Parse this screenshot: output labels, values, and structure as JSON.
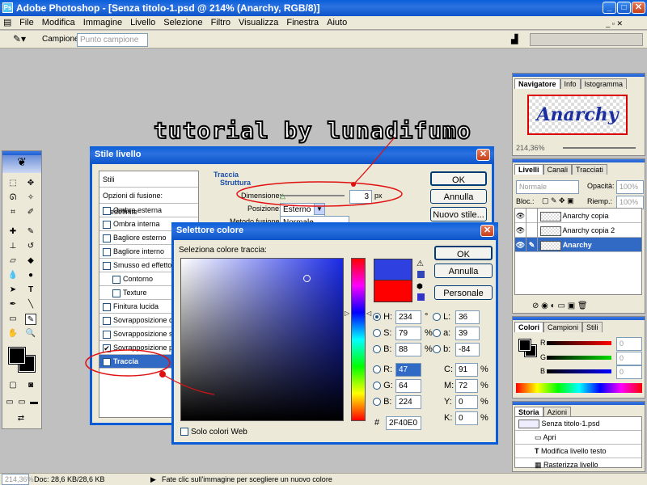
{
  "window": {
    "title": "Adobe Photoshop - [Senza titolo-1.psd @ 214% (Anarchy, RGB/8)]"
  },
  "menu": [
    "File",
    "Modifica",
    "Immagine",
    "Livello",
    "Selezione",
    "Filtro",
    "Visualizza",
    "Finestra",
    "Aiuto"
  ],
  "options": {
    "sample_label": "Campione:",
    "sample_value": "Punto campione"
  },
  "overlay": {
    "caption": "tutorial by lunadifumo"
  },
  "navigator": {
    "tabs": [
      "Navigatore",
      "Info",
      "Istogramma"
    ],
    "zoom": "214,36%",
    "preview_text": "Anarchy"
  },
  "layers_panel": {
    "tabs": [
      "Livelli",
      "Canali",
      "Tracciati"
    ],
    "blend": "Normale",
    "opacity_label": "Opacità:",
    "opacity": "100%",
    "lock_label": "Bloc.:",
    "fill_label": "Riemp.:",
    "fill": "100%",
    "layers": [
      "Anarchy copia",
      "Anarchy copia 2",
      "Anarchy"
    ]
  },
  "colors_panel": {
    "tabs": [
      "Colori",
      "Campioni",
      "Stili"
    ],
    "r_label": "R",
    "g_label": "G",
    "b_label": "B",
    "r": "0",
    "g": "0",
    "b": "0"
  },
  "history_panel": {
    "tabs": [
      "Storia",
      "Azioni"
    ],
    "snapshot": "Senza titolo-1.psd",
    "items": [
      "Apri",
      "Modifica livello testo",
      "Rasterizza livello"
    ]
  },
  "status": {
    "zoom": "214,36%",
    "doc": "Doc: 28,6 KB/28,6 KB",
    "hint": "Fate clic sull'immagine per scegliere un nuovo colore"
  },
  "style_dialog": {
    "title": "Stile livello",
    "list_header": "Stili",
    "options_label": "Opzioni di fusione: Predefinite",
    "items": [
      {
        "label": "Ombra esterna",
        "checked": false,
        "indent": false
      },
      {
        "label": "Ombra interna",
        "checked": false,
        "indent": false
      },
      {
        "label": "Bagliore esterno",
        "checked": false,
        "indent": false
      },
      {
        "label": "Bagliore interno",
        "checked": false,
        "indent": false
      },
      {
        "label": "Smusso ed effetto rilie",
        "checked": false,
        "indent": false
      },
      {
        "label": "Contorno",
        "checked": false,
        "indent": true
      },
      {
        "label": "Texture",
        "checked": false,
        "indent": true
      },
      {
        "label": "Finitura lucida",
        "checked": false,
        "indent": false
      },
      {
        "label": "Sovrapposizione colo",
        "checked": false,
        "indent": false
      },
      {
        "label": "Sovrapposizione sfum",
        "checked": false,
        "indent": false
      },
      {
        "label": "Sovrapposizione patt",
        "checked": true,
        "indent": false
      },
      {
        "label": "Traccia",
        "checked": true,
        "indent": false,
        "selected": true
      }
    ],
    "section": "Traccia",
    "subsection": "Struttura",
    "size_label": "Dimensione:",
    "size_value": "3",
    "size_unit": "px",
    "position_label": "Posizione:",
    "position_value": "Esterno",
    "blend_label": "Metodo fusione:",
    "blend_value": "Normale",
    "ok": "OK",
    "cancel": "Annulla",
    "new_style": "Nuovo stile..."
  },
  "picker": {
    "title": "Selettore colore",
    "prompt": "Seleziona colore traccia:",
    "ok": "OK",
    "cancel": "Annulla",
    "custom": "Personale",
    "web_only": "Solo colori Web",
    "new_color": "#2F40E0",
    "old_color": "#FF0000",
    "H_label": "H:",
    "H": "234",
    "H_unit": "°",
    "S_label": "S:",
    "S": "79",
    "S_unit": "%",
    "B_label": "B:",
    "B": "88",
    "B_unit": "%",
    "R_label": "R:",
    "R": "47",
    "G_label": "G:",
    "G": "64",
    "Bl_label": "B:",
    "Bl": "224",
    "L_label": "L:",
    "L": "36",
    "a_label": "a:",
    "a": "39",
    "b_label": "b:",
    "b": "-84",
    "C_label": "C:",
    "C": "91",
    "M_label": "M:",
    "M": "72",
    "Y_label": "Y:",
    "Y": "0",
    "K_label": "K:",
    "K": "0",
    "pct": "%",
    "hash": "#",
    "hex": "2F40E0"
  }
}
